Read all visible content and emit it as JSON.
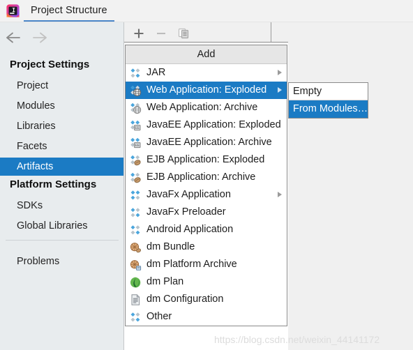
{
  "window": {
    "logo_icon": "intellij-idea-logo",
    "tab_title": "Project Structure"
  },
  "nav": {
    "back_icon": "arrow-left-icon",
    "forward_icon": "arrow-right-icon"
  },
  "sidebar": {
    "groups": [
      {
        "heading": "Project Settings",
        "items": [
          {
            "label": "Project",
            "selected": false
          },
          {
            "label": "Modules",
            "selected": false
          },
          {
            "label": "Libraries",
            "selected": false
          },
          {
            "label": "Facets",
            "selected": false
          },
          {
            "label": "Artifacts",
            "selected": true
          }
        ]
      },
      {
        "heading": "Platform Settings",
        "items": [
          {
            "label": "SDKs",
            "selected": false
          },
          {
            "label": "Global Libraries",
            "selected": false
          }
        ]
      }
    ],
    "extra_items": [
      {
        "label": "Problems",
        "selected": false
      }
    ]
  },
  "toolbar": {
    "buttons": [
      {
        "name": "add-button",
        "icon": "plus-icon",
        "tooltip": "Add"
      },
      {
        "name": "remove-button",
        "icon": "minus-icon",
        "tooltip": "Remove"
      },
      {
        "name": "copy-button",
        "icon": "copy-icon",
        "tooltip": "Copy"
      }
    ]
  },
  "add_menu": {
    "title": "Add",
    "items": [
      {
        "label": "JAR",
        "icon": "jar-icon",
        "has_submenu": true,
        "selected": false
      },
      {
        "label": "Web Application: Exploded",
        "icon": "web-exploded-icon",
        "has_submenu": true,
        "selected": true
      },
      {
        "label": "Web Application: Archive",
        "icon": "web-archive-icon",
        "has_submenu": false,
        "selected": false
      },
      {
        "label": "JavaEE Application: Exploded",
        "icon": "javaee-exploded-icon",
        "has_submenu": false,
        "selected": false
      },
      {
        "label": "JavaEE Application: Archive",
        "icon": "javaee-archive-icon",
        "has_submenu": false,
        "selected": false
      },
      {
        "label": "EJB Application: Exploded",
        "icon": "ejb-exploded-icon",
        "has_submenu": false,
        "selected": false
      },
      {
        "label": "EJB Application: Archive",
        "icon": "ejb-archive-icon",
        "has_submenu": false,
        "selected": false
      },
      {
        "label": "JavaFx Application",
        "icon": "javafx-icon",
        "has_submenu": true,
        "selected": false
      },
      {
        "label": "JavaFx Preloader",
        "icon": "javafx-preloader-icon",
        "has_submenu": false,
        "selected": false
      },
      {
        "label": "Android Application",
        "icon": "android-application-icon",
        "has_submenu": false,
        "selected": false
      },
      {
        "label": "dm Bundle",
        "icon": "dm-bundle-icon",
        "has_submenu": false,
        "selected": false
      },
      {
        "label": "dm Platform Archive",
        "icon": "dm-platform-archive-icon",
        "has_submenu": false,
        "selected": false
      },
      {
        "label": "dm Plan",
        "icon": "dm-plan-icon",
        "has_submenu": false,
        "selected": false
      },
      {
        "label": "dm Configuration",
        "icon": "dm-configuration-icon",
        "has_submenu": false,
        "selected": false
      },
      {
        "label": "Other",
        "icon": "other-icon",
        "has_submenu": false,
        "selected": false
      }
    ]
  },
  "sub_menu": {
    "items": [
      {
        "label": "Empty",
        "selected": false
      },
      {
        "label": "From Modules…",
        "selected": true
      }
    ]
  },
  "watermark": {
    "text": "https://blog.csdn.net/weixin_44141172"
  },
  "colors": {
    "selection_blue": "#1b7bc4",
    "sidebar_bg": "#e8ecee",
    "panel_bg": "#f0f0f0",
    "menu_bg": "#ffffff",
    "menu_title_bg": "#e6e6e6",
    "tab_underline": "#4a86c8"
  }
}
